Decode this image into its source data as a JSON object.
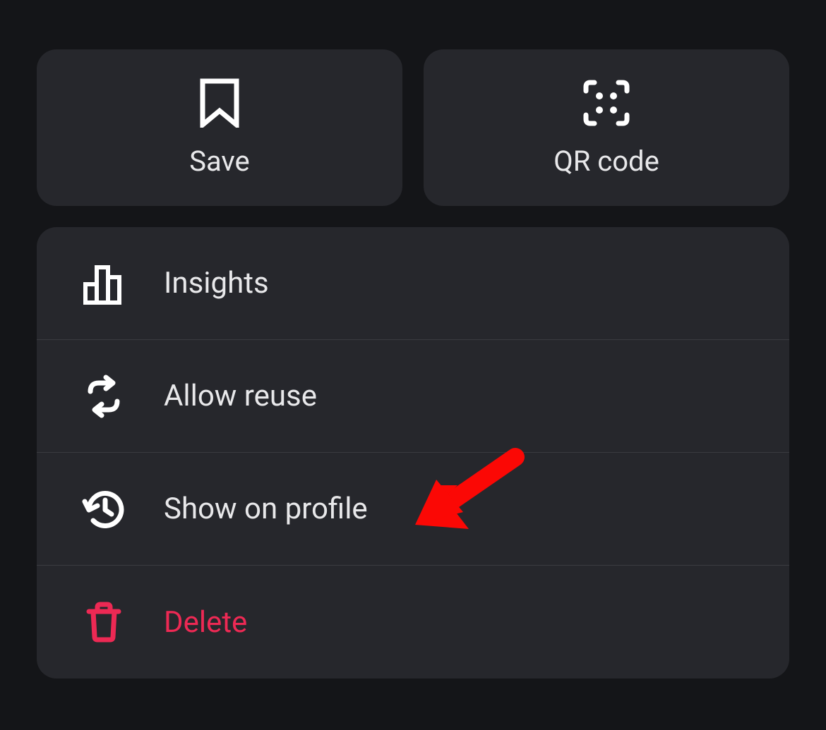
{
  "topButtons": {
    "save": {
      "label": "Save"
    },
    "qrCode": {
      "label": "QR code"
    }
  },
  "menuItems": {
    "insights": {
      "label": "Insights"
    },
    "allowReuse": {
      "label": "Allow reuse"
    },
    "showOnProfile": {
      "label": "Show on profile"
    },
    "delete": {
      "label": "Delete"
    }
  },
  "colors": {
    "background": "#141518",
    "card": "#26272c",
    "text": "#e8e8ea",
    "danger": "#ed2954",
    "annotation": "#fb0805"
  }
}
